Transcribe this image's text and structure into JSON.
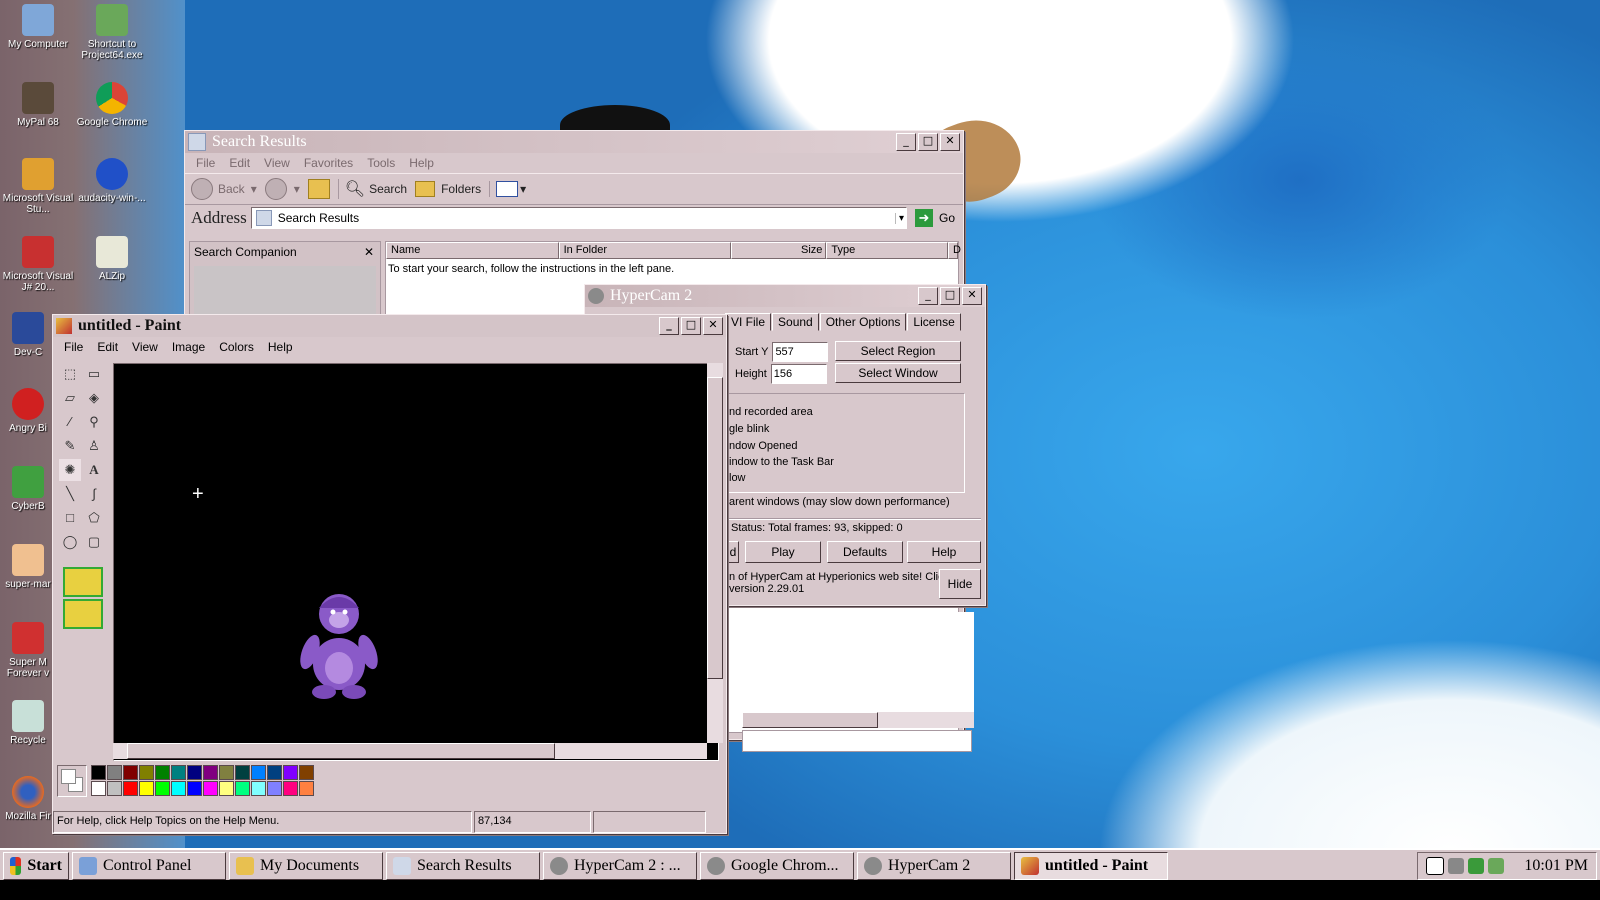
{
  "desktop": {
    "icons": [
      {
        "label": "My Computer"
      },
      {
        "label": "Shortcut to Project64.exe"
      },
      {
        "label": "MyPal 68"
      },
      {
        "label": "Google Chrome"
      },
      {
        "label": "Microsoft Visual Stu..."
      },
      {
        "label": "audacity-win-..."
      },
      {
        "label": "Microsoft Visual J# 20..."
      },
      {
        "label": "ALZip"
      },
      {
        "label": "Dev-C"
      },
      {
        "label": "Angry Bi"
      },
      {
        "label": "CyberB"
      },
      {
        "label": "super-mar"
      },
      {
        "label": "Super M Forever v"
      },
      {
        "label": "Recycle"
      },
      {
        "label": "Mozilla Fir"
      }
    ]
  },
  "search_window": {
    "title": "Search Results",
    "menu": [
      "File",
      "Edit",
      "View",
      "Favorites",
      "Tools",
      "Help"
    ],
    "toolbar": {
      "back": "Back",
      "search": "Search",
      "folders": "Folders"
    },
    "address_label": "Address",
    "address_value": "Search Results",
    "go": "Go",
    "companion_title": "Search Companion",
    "columns": [
      "Name",
      "In Folder",
      "Size",
      "Type",
      "D"
    ],
    "message": "To start your search, follow the instructions in the left pane."
  },
  "hypercam": {
    "title": "HyperCam 2",
    "tabs": [
      "VI File",
      "Sound",
      "Other Options",
      "License"
    ],
    "start_y_label": "Start Y",
    "start_y_value": "557",
    "height_label": "Height",
    "height_value": "156",
    "select_region": "Select Region",
    "select_window": "Select Window",
    "options": [
      "nd recorded area",
      "gle blink",
      "ndow Opened",
      "indow to the Task Bar",
      "low"
    ],
    "parent_option": "arent windows (may slow down performance)",
    "status": "Status: Total frames: 93, skipped: 0",
    "buttons": {
      "rec": "d",
      "play": "Play",
      "defaults": "Defaults",
      "help": "Help",
      "hide": "Hide"
    },
    "info_line1": "n of HyperCam at Hyperionics web site! Click",
    "info_line2": "version 2.29.01"
  },
  "paint": {
    "title": "untitled - Paint",
    "menu": [
      "File",
      "Edit",
      "View",
      "Image",
      "Colors",
      "Help"
    ],
    "status_help": "For Help, click Help Topics on the Help Menu.",
    "coords": "87,134",
    "palette_top": [
      "#000000",
      "#808080",
      "#800000",
      "#808000",
      "#008000",
      "#008080",
      "#000080",
      "#800080",
      "#808040",
      "#004040",
      "#0080ff",
      "#004080",
      "#8000ff",
      "#804000"
    ],
    "palette_bottom": [
      "#ffffff",
      "#c0c0c0",
      "#ff0000",
      "#ffff00",
      "#00ff00",
      "#00ffff",
      "#0000ff",
      "#ff00ff",
      "#ffff80",
      "#00ff80",
      "#80ffff",
      "#8080ff",
      "#ff0080",
      "#ff8040"
    ]
  },
  "taskbar": {
    "start": "Start",
    "items": [
      "Control Panel",
      "My Documents",
      "Search Results",
      "HyperCam 2 : ...",
      "Google Chrom...",
      "HyperCam 2",
      "untitled - Paint"
    ],
    "clock": "10:01 PM"
  }
}
